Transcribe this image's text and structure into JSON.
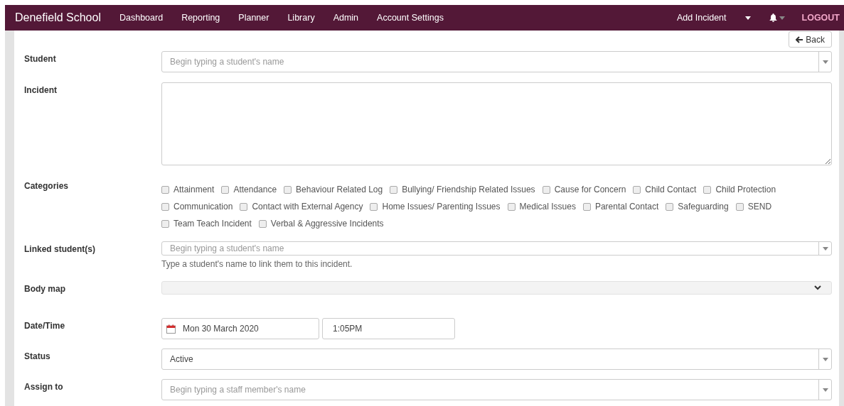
{
  "navbar": {
    "brand": "Denefield School",
    "links": [
      {
        "label": "Dashboard"
      },
      {
        "label": "Reporting"
      },
      {
        "label": "Planner"
      },
      {
        "label": "Library"
      },
      {
        "label": "Admin"
      },
      {
        "label": "Account Settings"
      }
    ],
    "add_incident": "Add Incident",
    "logout": "LOGOUT"
  },
  "back_button": "Back",
  "form": {
    "student": {
      "label": "Student",
      "placeholder": "Begin typing a student's name"
    },
    "incident": {
      "label": "Incident"
    },
    "categories": {
      "label": "Categories",
      "options": [
        {
          "label": "Attainment",
          "checked": false
        },
        {
          "label": "Attendance",
          "checked": false
        },
        {
          "label": "Behaviour Related Log",
          "checked": false
        },
        {
          "label": "Bullying/ Friendship Related Issues",
          "checked": false
        },
        {
          "label": "Cause for Concern",
          "checked": false
        },
        {
          "label": "Child Contact",
          "checked": false
        },
        {
          "label": "Child Protection",
          "checked": false
        },
        {
          "label": "Communication",
          "checked": false
        },
        {
          "label": "Contact with External Agency",
          "checked": false
        },
        {
          "label": "Home Issues/ Parenting Issues",
          "checked": false
        },
        {
          "label": "Medical Issues",
          "checked": false
        },
        {
          "label": "Parental Contact",
          "checked": false
        },
        {
          "label": "Safeguarding",
          "checked": false
        },
        {
          "label": "SEND",
          "checked": false
        },
        {
          "label": "Team Teach Incident",
          "checked": false
        },
        {
          "label": "Verbal & Aggressive Incidents",
          "checked": false
        }
      ]
    },
    "linked_students": {
      "label": "Linked student(s)",
      "placeholder": "Begin typing a student's name",
      "help": "Type a student's name to link them to this incident."
    },
    "body_map": {
      "label": "Body map",
      "expanded": false
    },
    "date_time": {
      "label": "Date/Time",
      "date": "Mon 30 March 2020",
      "time": "1:05PM"
    },
    "status": {
      "label": "Status",
      "value": "Active"
    },
    "assign_to": {
      "label": "Assign to",
      "placeholder": "Begin typing a staff member's name"
    }
  }
}
